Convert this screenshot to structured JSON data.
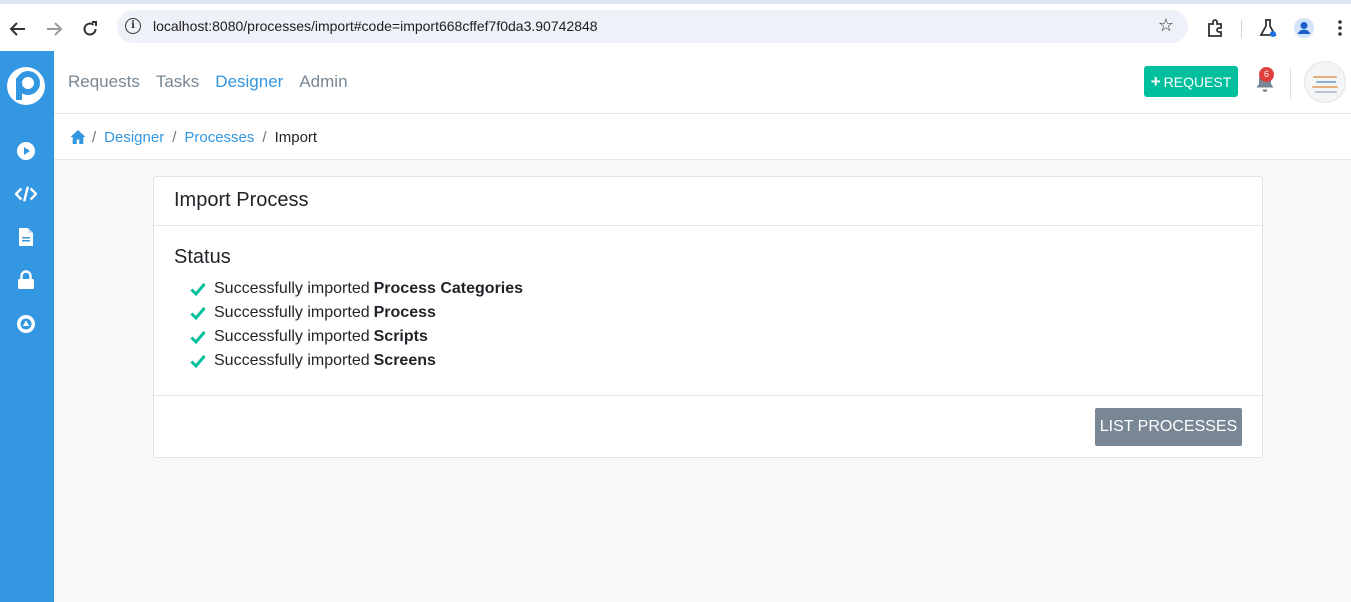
{
  "browser": {
    "url": "localhost:8080/processes/import#code=import668cffef7f0da3.90742848"
  },
  "nav": {
    "items": [
      {
        "label": "Requests"
      },
      {
        "label": "Tasks"
      },
      {
        "label": "Designer"
      },
      {
        "label": "Admin"
      }
    ],
    "active": "Designer",
    "request_button": "REQUEST",
    "notification_count": "6"
  },
  "breadcrumb": {
    "designer": "Designer",
    "processes": "Processes",
    "current": "Import",
    "separator": "/"
  },
  "card": {
    "title": "Import Process",
    "status_heading": "Status",
    "status_items": [
      {
        "prefix": "Successfully imported",
        "item": "Process Categories"
      },
      {
        "prefix": "Successfully imported",
        "item": "Process"
      },
      {
        "prefix": "Successfully imported",
        "item": "Scripts"
      },
      {
        "prefix": "Successfully imported",
        "item": "Screens"
      }
    ],
    "footer_button": "LIST PROCESSES"
  },
  "colors": {
    "sidebar": "#3397e2",
    "accent": "#3397e2",
    "success": "#00bf9c",
    "secondary_button": "#788793",
    "badge": "#e03d3d"
  }
}
